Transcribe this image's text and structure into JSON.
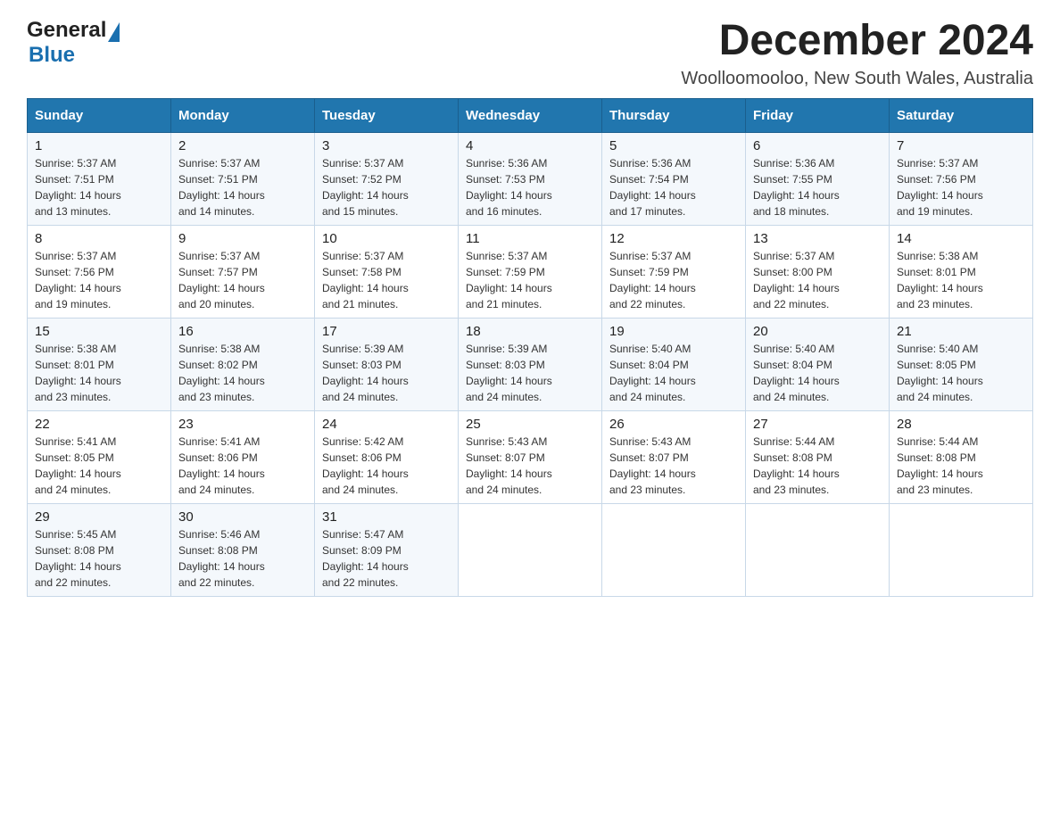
{
  "header": {
    "logo_general": "General",
    "logo_blue": "Blue",
    "month_title": "December 2024",
    "location": "Woolloomooloo, New South Wales, Australia"
  },
  "days_of_week": [
    "Sunday",
    "Monday",
    "Tuesday",
    "Wednesday",
    "Thursday",
    "Friday",
    "Saturday"
  ],
  "weeks": [
    [
      {
        "day": "1",
        "sunrise": "5:37 AM",
        "sunset": "7:51 PM",
        "daylight": "14 hours and 13 minutes."
      },
      {
        "day": "2",
        "sunrise": "5:37 AM",
        "sunset": "7:51 PM",
        "daylight": "14 hours and 14 minutes."
      },
      {
        "day": "3",
        "sunrise": "5:37 AM",
        "sunset": "7:52 PM",
        "daylight": "14 hours and 15 minutes."
      },
      {
        "day": "4",
        "sunrise": "5:36 AM",
        "sunset": "7:53 PM",
        "daylight": "14 hours and 16 minutes."
      },
      {
        "day": "5",
        "sunrise": "5:36 AM",
        "sunset": "7:54 PM",
        "daylight": "14 hours and 17 minutes."
      },
      {
        "day": "6",
        "sunrise": "5:36 AM",
        "sunset": "7:55 PM",
        "daylight": "14 hours and 18 minutes."
      },
      {
        "day": "7",
        "sunrise": "5:37 AM",
        "sunset": "7:56 PM",
        "daylight": "14 hours and 19 minutes."
      }
    ],
    [
      {
        "day": "8",
        "sunrise": "5:37 AM",
        "sunset": "7:56 PM",
        "daylight": "14 hours and 19 minutes."
      },
      {
        "day": "9",
        "sunrise": "5:37 AM",
        "sunset": "7:57 PM",
        "daylight": "14 hours and 20 minutes."
      },
      {
        "day": "10",
        "sunrise": "5:37 AM",
        "sunset": "7:58 PM",
        "daylight": "14 hours and 21 minutes."
      },
      {
        "day": "11",
        "sunrise": "5:37 AM",
        "sunset": "7:59 PM",
        "daylight": "14 hours and 21 minutes."
      },
      {
        "day": "12",
        "sunrise": "5:37 AM",
        "sunset": "7:59 PM",
        "daylight": "14 hours and 22 minutes."
      },
      {
        "day": "13",
        "sunrise": "5:37 AM",
        "sunset": "8:00 PM",
        "daylight": "14 hours and 22 minutes."
      },
      {
        "day": "14",
        "sunrise": "5:38 AM",
        "sunset": "8:01 PM",
        "daylight": "14 hours and 23 minutes."
      }
    ],
    [
      {
        "day": "15",
        "sunrise": "5:38 AM",
        "sunset": "8:01 PM",
        "daylight": "14 hours and 23 minutes."
      },
      {
        "day": "16",
        "sunrise": "5:38 AM",
        "sunset": "8:02 PM",
        "daylight": "14 hours and 23 minutes."
      },
      {
        "day": "17",
        "sunrise": "5:39 AM",
        "sunset": "8:03 PM",
        "daylight": "14 hours and 24 minutes."
      },
      {
        "day": "18",
        "sunrise": "5:39 AM",
        "sunset": "8:03 PM",
        "daylight": "14 hours and 24 minutes."
      },
      {
        "day": "19",
        "sunrise": "5:40 AM",
        "sunset": "8:04 PM",
        "daylight": "14 hours and 24 minutes."
      },
      {
        "day": "20",
        "sunrise": "5:40 AM",
        "sunset": "8:04 PM",
        "daylight": "14 hours and 24 minutes."
      },
      {
        "day": "21",
        "sunrise": "5:40 AM",
        "sunset": "8:05 PM",
        "daylight": "14 hours and 24 minutes."
      }
    ],
    [
      {
        "day": "22",
        "sunrise": "5:41 AM",
        "sunset": "8:05 PM",
        "daylight": "14 hours and 24 minutes."
      },
      {
        "day": "23",
        "sunrise": "5:41 AM",
        "sunset": "8:06 PM",
        "daylight": "14 hours and 24 minutes."
      },
      {
        "day": "24",
        "sunrise": "5:42 AM",
        "sunset": "8:06 PM",
        "daylight": "14 hours and 24 minutes."
      },
      {
        "day": "25",
        "sunrise": "5:43 AM",
        "sunset": "8:07 PM",
        "daylight": "14 hours and 24 minutes."
      },
      {
        "day": "26",
        "sunrise": "5:43 AM",
        "sunset": "8:07 PM",
        "daylight": "14 hours and 23 minutes."
      },
      {
        "day": "27",
        "sunrise": "5:44 AM",
        "sunset": "8:08 PM",
        "daylight": "14 hours and 23 minutes."
      },
      {
        "day": "28",
        "sunrise": "5:44 AM",
        "sunset": "8:08 PM",
        "daylight": "14 hours and 23 minutes."
      }
    ],
    [
      {
        "day": "29",
        "sunrise": "5:45 AM",
        "sunset": "8:08 PM",
        "daylight": "14 hours and 22 minutes."
      },
      {
        "day": "30",
        "sunrise": "5:46 AM",
        "sunset": "8:08 PM",
        "daylight": "14 hours and 22 minutes."
      },
      {
        "day": "31",
        "sunrise": "5:47 AM",
        "sunset": "8:09 PM",
        "daylight": "14 hours and 22 minutes."
      },
      null,
      null,
      null,
      null
    ]
  ],
  "labels": {
    "sunrise": "Sunrise:",
    "sunset": "Sunset:",
    "daylight": "Daylight:"
  }
}
